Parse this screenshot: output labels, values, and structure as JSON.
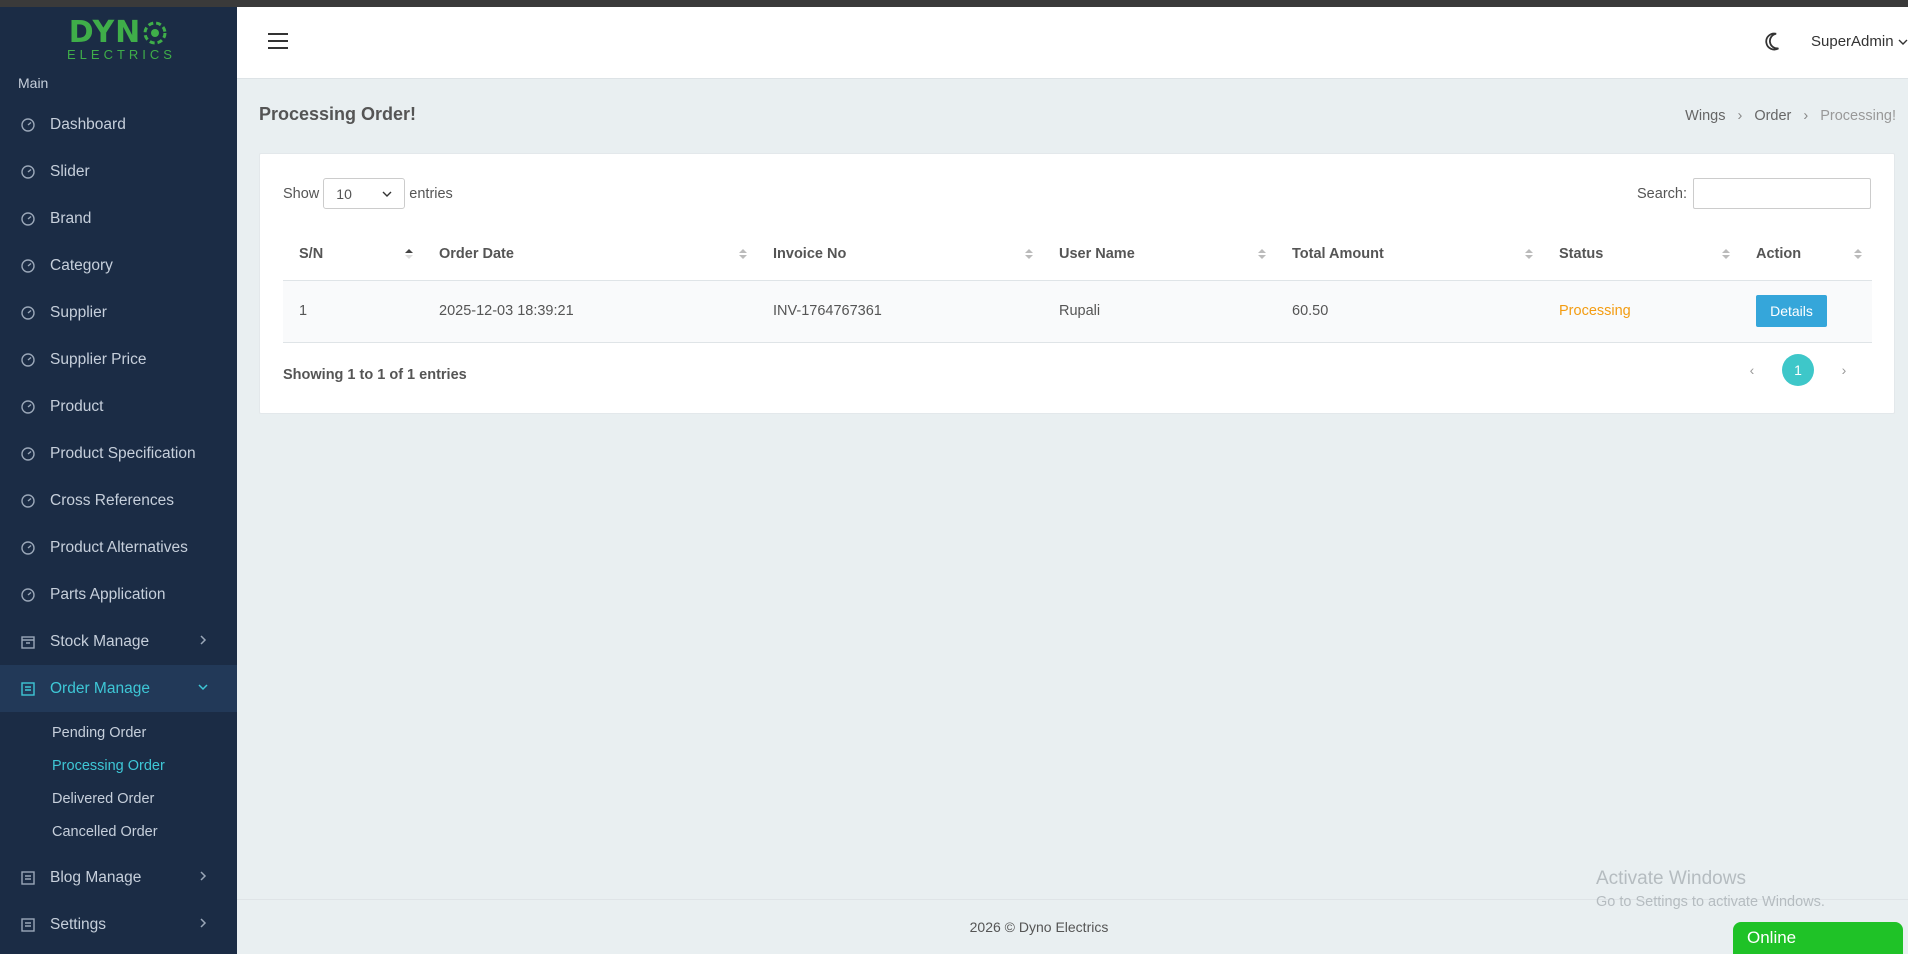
{
  "brand": {
    "logo_top": "DYN",
    "logo_bottom": "ELECTRICS",
    "color": "#3fae49"
  },
  "sidebar": {
    "section_label": "Main",
    "items": [
      {
        "label": "Dashboard",
        "icon": "gauge-icon"
      },
      {
        "label": "Slider",
        "icon": "gauge-icon"
      },
      {
        "label": "Brand",
        "icon": "gauge-icon"
      },
      {
        "label": "Category",
        "icon": "gauge-icon"
      },
      {
        "label": "Supplier",
        "icon": "gauge-icon"
      },
      {
        "label": "Supplier Price",
        "icon": "gauge-icon"
      },
      {
        "label": "Product",
        "icon": "gauge-icon"
      },
      {
        "label": "Product Specification",
        "icon": "gauge-icon"
      },
      {
        "label": "Cross References",
        "icon": "gauge-icon"
      },
      {
        "label": "Product Alternatives",
        "icon": "gauge-icon"
      },
      {
        "label": "Parts Application",
        "icon": "gauge-icon"
      },
      {
        "label": "Stock Manage",
        "icon": "archive-icon"
      },
      {
        "label": "Order Manage",
        "icon": "list-icon"
      },
      {
        "label": "Blog Manage",
        "icon": "list-icon"
      },
      {
        "label": "Settings",
        "icon": "list-icon"
      }
    ],
    "order_submenu": [
      "Pending Order",
      "Processing Order",
      "Delivered Order",
      "Cancelled Order"
    ],
    "active_item": "Order Manage",
    "active_subitem": "Processing Order"
  },
  "header": {
    "user": "SuperAdmin"
  },
  "page": {
    "title": "Processing Order!",
    "breadcrumb": [
      "Wings",
      "Order",
      "Processing!"
    ]
  },
  "table": {
    "show_label": "Show",
    "entries_label": "entries",
    "page_size": "10",
    "search_label": "Search:",
    "search_value": "",
    "columns": [
      "S/N",
      "Order Date",
      "Invoice No",
      "User Name",
      "Total Amount",
      "Status",
      "Action"
    ],
    "rows": [
      {
        "sn": "1",
        "order_date": "2025-12-03 18:39:21",
        "invoice": "INV-1764767361",
        "user": "Rupali",
        "total": "60.50",
        "status": "Processing",
        "action": "Details"
      }
    ],
    "info": "Showing 1 to 1 of 1 entries",
    "current_page": "1",
    "prev_icon": "chevron-left-icon",
    "next_icon": "chevron-right-icon"
  },
  "footer": {
    "text": "2026 © Dyno Electrics"
  },
  "watermark": {
    "line1": "Activate Windows",
    "line2": "Go to Settings to activate Windows."
  },
  "chat": {
    "label": "Online",
    "color": "#1fc227"
  },
  "colors": {
    "sidebar_bg": "#1b2c45",
    "accent": "#3ec7d6",
    "status_processing": "#f39c12",
    "button": "#35a6da"
  }
}
